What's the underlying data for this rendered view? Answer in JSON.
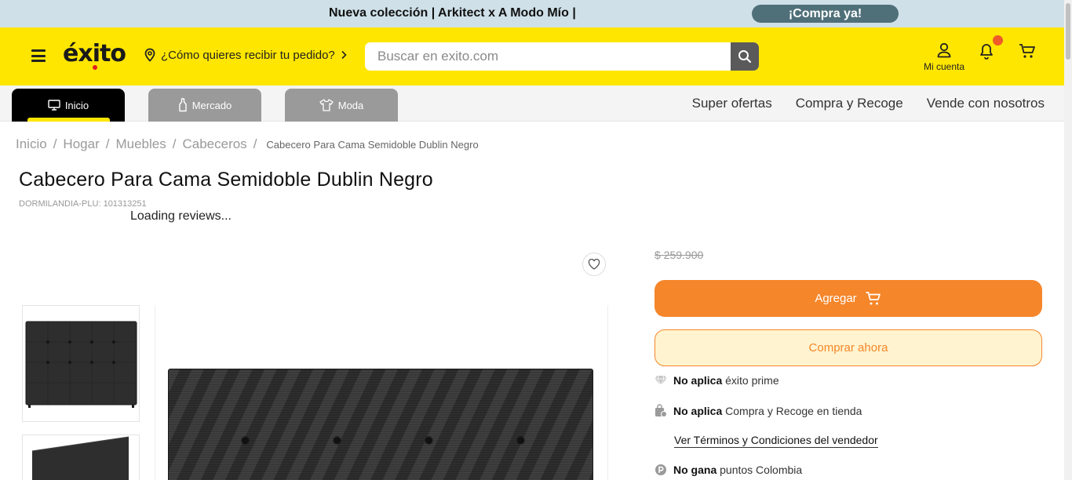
{
  "promo": {
    "text": "Nueva colección | Arkitect x A Modo Mío |",
    "cta": "¡Compra ya!"
  },
  "header": {
    "logo": "éxito",
    "location_prompt": "¿Cómo quieres recibir tu pedido?",
    "search_placeholder": "Buscar en exito.com",
    "account_label": "Mi cuenta"
  },
  "tabs": [
    {
      "label": "Inicio",
      "icon": "monitor-icon"
    },
    {
      "label": "Mercado",
      "icon": "bottle-icon"
    },
    {
      "label": "Moda",
      "icon": "shirt-icon"
    }
  ],
  "nav_links": [
    "Super ofertas",
    "Compra y Recoge",
    "Vende con nosotros"
  ],
  "breadcrumb": [
    "Inicio",
    "Hogar",
    "Muebles",
    "Cabeceros"
  ],
  "breadcrumb_current": "Cabecero Para Cama Semidoble Dublin Negro",
  "product": {
    "title": "Cabecero Para Cama Semidoble Dublin Negro",
    "sku": "DORMILANDIA-PLU: 101313251",
    "reviews_status": "Loading reviews...",
    "old_price": "$ 259.900"
  },
  "actions": {
    "add_label": "Agregar",
    "buy_now_label": "Comprar ahora"
  },
  "info": {
    "prime_bold": "No aplica",
    "prime_text": "éxito prime",
    "pickup_bold": "No aplica",
    "pickup_text": "Compra y Recoge en tienda",
    "terms_link": "Ver Términos y Condiciones del vendedor",
    "points_bold": "No gana",
    "points_text": "puntos Colombia"
  },
  "colors": {
    "brand_yellow": "#ffe600",
    "accent_orange": "#f5862a",
    "promo_bg": "#cfe0e8"
  }
}
